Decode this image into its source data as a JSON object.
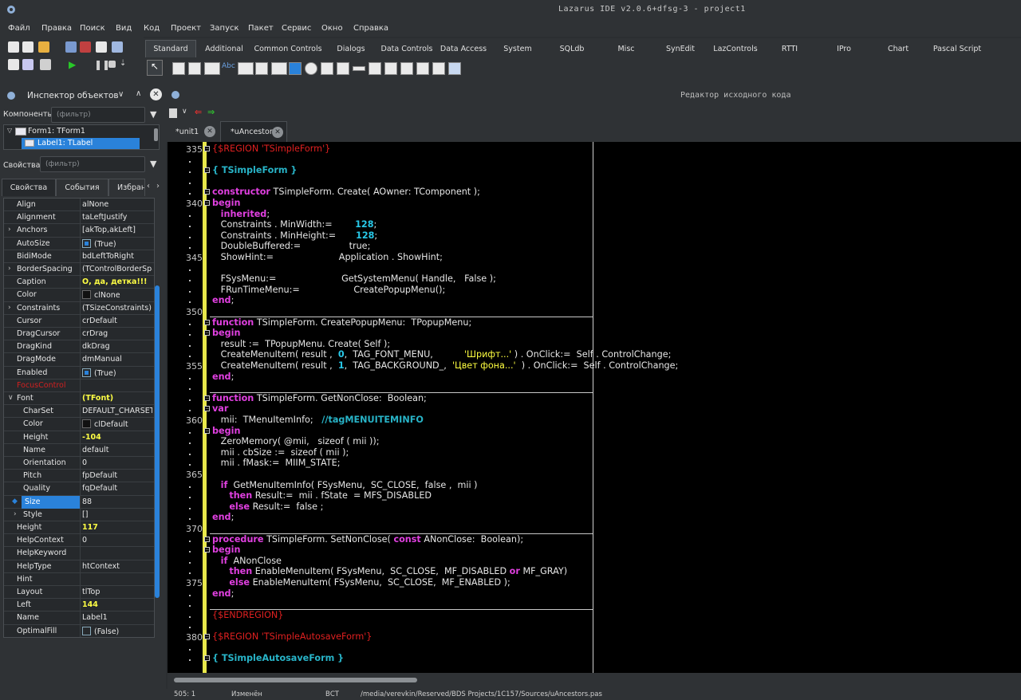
{
  "window": {
    "title": "Lazarus IDE v2.0.6+dfsg-3 - project1"
  },
  "menu": [
    "Файл",
    "Правка",
    "Поиск",
    "Вид",
    "Код",
    "Проект",
    "Запуск",
    "Пакет",
    "Сервис",
    "Окно",
    "Справка"
  ],
  "palette_tabs": [
    "Standard",
    "Additional",
    "Common Controls",
    "Dialogs",
    "Data Controls",
    "Data Access",
    "System",
    "SQLdb",
    "Misc",
    "SynEdit",
    "LazControls",
    "RTTI",
    "IPro",
    "Chart",
    "Pascal Script"
  ],
  "palette_active": "Standard",
  "inspector": {
    "title": "Инспектор объектов",
    "components_label": "Компоненты",
    "components_filter_placeholder": "(фильтр)",
    "tree": [
      "Form1: TForm1",
      "Label1: TLabel"
    ],
    "properties_label": "Свойства",
    "properties_filter_placeholder": "(фильтр)",
    "tabs": [
      "Свойства",
      "События",
      "Избранн"
    ],
    "properties": [
      {
        "name": "Align",
        "value": "alNone"
      },
      {
        "name": "Alignment",
        "value": "taLeftJustify"
      },
      {
        "name": "Anchors",
        "value": "[akTop,akLeft]",
        "expand": true
      },
      {
        "name": "AutoSize",
        "value": "(True)",
        "check": "on"
      },
      {
        "name": "BidiMode",
        "value": "bdLeftToRight"
      },
      {
        "name": "BorderSpacing",
        "value": "(TControlBorderSpa",
        "expand": true
      },
      {
        "name": "Caption",
        "value": "О, да, детка!!!",
        "highlight": true
      },
      {
        "name": "Color",
        "value": "clNone",
        "swatch": true
      },
      {
        "name": "Constraints",
        "value": "(TSizeConstraints)",
        "expand": true
      },
      {
        "name": "Cursor",
        "value": "crDefault"
      },
      {
        "name": "DragCursor",
        "value": "crDrag"
      },
      {
        "name": "DragKind",
        "value": "dkDrag"
      },
      {
        "name": "DragMode",
        "value": "dmManual"
      },
      {
        "name": "Enabled",
        "value": "(True)",
        "check": "on"
      },
      {
        "name": "FocusControl",
        "value": "",
        "red": true
      },
      {
        "name": "Font",
        "value": "(TFont)",
        "highlight": true,
        "expand": true,
        "expanded": true
      },
      {
        "name": "CharSet",
        "value": "DEFAULT_CHARSET",
        "sub": true
      },
      {
        "name": "Color",
        "value": "clDefault",
        "sub": true,
        "swatch": true
      },
      {
        "name": "Height",
        "value": "-104",
        "sub": true,
        "highlight": true
      },
      {
        "name": "Name",
        "value": "default",
        "sub": true
      },
      {
        "name": "Orientation",
        "value": "0",
        "sub": true
      },
      {
        "name": "Pitch",
        "value": "fpDefault",
        "sub": true
      },
      {
        "name": "Quality",
        "value": "fqDefault",
        "sub": true
      },
      {
        "name": "Size",
        "value": "88",
        "sub": true,
        "selected": true
      },
      {
        "name": "Style",
        "value": "[]",
        "sub": true,
        "expand": true
      },
      {
        "name": "Height",
        "value": "117",
        "highlight": true
      },
      {
        "name": "HelpContext",
        "value": "0"
      },
      {
        "name": "HelpKeyword",
        "value": ""
      },
      {
        "name": "HelpType",
        "value": "htContext"
      },
      {
        "name": "Hint",
        "value": ""
      },
      {
        "name": "Layout",
        "value": "tlTop"
      },
      {
        "name": "Left",
        "value": "144",
        "highlight": true
      },
      {
        "name": "Name",
        "value": "Label1"
      },
      {
        "name": "OptimalFill",
        "value": "(False)",
        "check": "off"
      }
    ]
  },
  "editor": {
    "title": "Редактор исходного кода",
    "tabs": [
      {
        "label": "*unit1",
        "active": false
      },
      {
        "label": "*uAncestors",
        "active": true
      }
    ],
    "line_numbers": [
      "335",
      "340",
      "345",
      "350",
      "355",
      "360",
      "365",
      "370",
      "375",
      "380"
    ],
    "lines": [
      [
        [
          "{$REGION 'TSimpleForm'}",
          "dir"
        ]
      ],
      [],
      [
        [
          "{ TSimpleForm }",
          "cm"
        ]
      ],
      [],
      [
        [
          "constructor",
          "kw"
        ],
        [
          " TSimpleForm. Create( AOwner: TComponent );",
          ""
        ]
      ],
      [
        [
          "begin",
          "kw"
        ]
      ],
      [
        [
          "   ",
          ""
        ],
        [
          "inherited",
          "kw"
        ],
        [
          ";",
          ""
        ]
      ],
      [
        [
          "   Constraints . MinWidth:=        ",
          ""
        ],
        [
          "128",
          "num"
        ],
        [
          ";",
          ""
        ]
      ],
      [
        [
          "   Constraints . MinHeight:=       ",
          ""
        ],
        [
          "128",
          "num"
        ],
        [
          ";",
          ""
        ]
      ],
      [
        [
          "   DoubleBuffered:=                 true;",
          ""
        ]
      ],
      [
        [
          "   ShowHint:=                       Application . ShowHint;",
          ""
        ]
      ],
      [],
      [
        [
          "   FSysMenu:=                       GetSystemMenu( Handle,   False );",
          ""
        ]
      ],
      [
        [
          "   FRunTimeMenu:=                   CreatePopupMenu();",
          ""
        ]
      ],
      [
        [
          "end",
          "kw"
        ],
        [
          ";",
          ""
        ]
      ],
      [],
      [
        [
          "function",
          "kw"
        ],
        [
          " TSimpleForm. CreatePopupMenu:  TPopupMenu;",
          ""
        ]
      ],
      [
        [
          "begin",
          "kw"
        ]
      ],
      [
        [
          "   result :=  TPopupMenu. Create( Self );",
          ""
        ]
      ],
      [
        [
          "   CreateMenuItem( result ,  ",
          ""
        ],
        [
          "0",
          "num"
        ],
        [
          ",  TAG_FONT_MENU,           ",
          ""
        ],
        [
          "'Шрифт...'",
          "str"
        ],
        [
          " ) . OnClick:=  Self . ControlChange;",
          ""
        ]
      ],
      [
        [
          "   CreateMenuItem( result ,  ",
          ""
        ],
        [
          "1",
          "num"
        ],
        [
          ",  TAG_BACKGROUND_,  ",
          ""
        ],
        [
          "'Цвет фона...'",
          "str"
        ],
        [
          "  ) . OnClick:=  Self . ControlChange;",
          ""
        ]
      ],
      [
        [
          "end",
          "kw"
        ],
        [
          ";",
          ""
        ]
      ],
      [],
      [
        [
          "function",
          "kw"
        ],
        [
          " TSimpleForm. GetNonClose:  Boolean;",
          ""
        ]
      ],
      [
        [
          "var",
          "kw"
        ]
      ],
      [
        [
          "   mii:  TMenuItemInfo;   ",
          ""
        ],
        [
          "//tagMENUITEMINFO",
          "cm"
        ]
      ],
      [
        [
          "begin",
          "kw"
        ]
      ],
      [
        [
          "   ZeroMemory( @mii,   sizeof ( mii ));",
          ""
        ]
      ],
      [
        [
          "   mii . cbSize :=  sizeof ( mii );",
          ""
        ]
      ],
      [
        [
          "   mii . fMask:=  MIIM_STATE;",
          ""
        ]
      ],
      [],
      [
        [
          "   ",
          ""
        ],
        [
          "if",
          "kw"
        ],
        [
          "  GetMenuItemInfo( FSysMenu,  SC_CLOSE,  false ,  mii )",
          ""
        ]
      ],
      [
        [
          "      ",
          ""
        ],
        [
          "then",
          "kw"
        ],
        [
          " Result:=  mii . fState  = MFS_DISABLED",
          ""
        ]
      ],
      [
        [
          "      ",
          ""
        ],
        [
          "else",
          "kw"
        ],
        [
          " Result:=  false ;",
          ""
        ]
      ],
      [
        [
          "end",
          "kw"
        ],
        [
          ";",
          ""
        ]
      ],
      [],
      [
        [
          "procedure",
          "kw"
        ],
        [
          " TSimpleForm. SetNonClose( ",
          ""
        ],
        [
          "const",
          "kw"
        ],
        [
          " ANonClose:  Boolean);",
          ""
        ]
      ],
      [
        [
          "begin",
          "kw"
        ]
      ],
      [
        [
          "   ",
          ""
        ],
        [
          "if",
          "kw"
        ],
        [
          "  ANonClose",
          ""
        ]
      ],
      [
        [
          "      ",
          ""
        ],
        [
          "then",
          "kw"
        ],
        [
          " EnableMenuItem( FSysMenu,  SC_CLOSE,  MF_DISABLED ",
          ""
        ],
        [
          "or",
          "kw"
        ],
        [
          " MF_GRAY)",
          ""
        ]
      ],
      [
        [
          "      ",
          ""
        ],
        [
          "else",
          "kw"
        ],
        [
          " EnableMenuItem( FSysMenu,  SC_CLOSE,  MF_ENABLED );",
          ""
        ]
      ],
      [
        [
          "end",
          "kw"
        ],
        [
          ";",
          ""
        ]
      ],
      [],
      [
        [
          "{$ENDREGION}",
          "dir"
        ]
      ],
      [],
      [
        [
          "{$REGION 'TSimpleAutosaveForm'}",
          "dir"
        ]
      ],
      [],
      [
        [
          "{ TSimpleAutosaveForm }",
          "cm"
        ]
      ]
    ]
  },
  "status": {
    "position": "505:  1",
    "modified": "Изменён",
    "mode": "ВСТ",
    "path": "/media/verevkin/Reserved/BDS Projects/1C157/Sources/uAncestors.pas"
  },
  "colors": {
    "keyword": "#e040e0",
    "directive": "#e02020",
    "comment": "#28b4c8",
    "number": "#28c8e8",
    "string": "#ffff40",
    "selection": "#2a82da",
    "change_bar": "#e8e84a"
  }
}
